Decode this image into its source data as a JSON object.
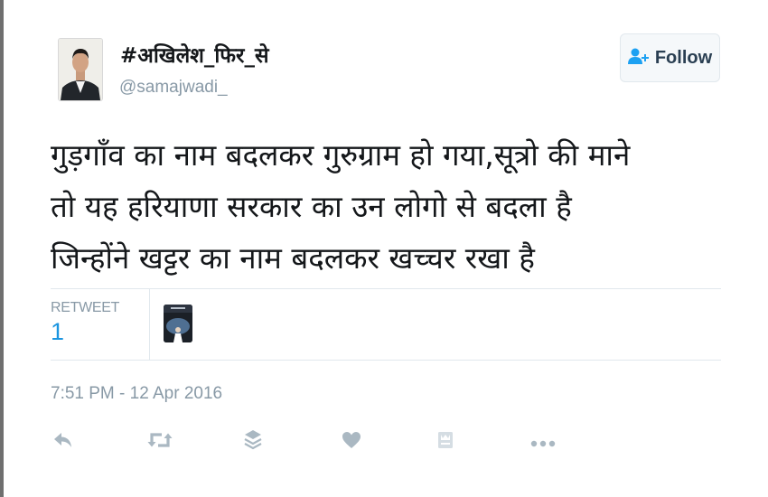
{
  "user": {
    "display_name": "#अखिलेश_फिर_से",
    "handle": "@samajwadi_"
  },
  "follow_button": {
    "label": "Follow",
    "icon": "add-user-icon"
  },
  "tweet": {
    "lines": [
      "गुड़गाँव का नाम बदलकर गुरुग्राम हो गया,सूत्रो की माने",
      "तो यह हरियाणा सरकार का उन लोगो से बदला है",
      "जिन्होंने खट्टर का नाम बदलकर खच्चर रखा है"
    ],
    "timestamp": "7:51 PM - 12 Apr 2016"
  },
  "stats": {
    "retweets_label": "RETWEET",
    "retweets_count": "1"
  },
  "actions": [
    "reply-icon",
    "retweet-icon",
    "stack-icon",
    "heart-icon",
    "bookmark-icon",
    "more-icon"
  ],
  "colors": {
    "icon_gray": "#aab8c2",
    "stat_blue": "#1b95e0",
    "follow_icon_blue": "#1da1f2"
  }
}
